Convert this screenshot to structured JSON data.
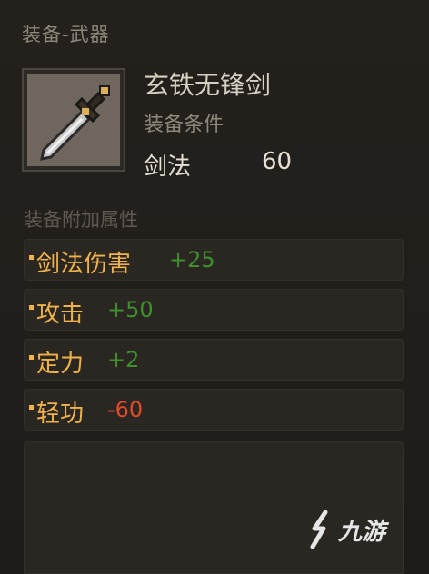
{
  "header": {
    "title": "装备-武器"
  },
  "item": {
    "name": "玄铁无锋剑",
    "requirement_label": "装备条件",
    "requirement_skill": "剑法",
    "requirement_value": "60"
  },
  "attributes": {
    "title": "装备附加属性",
    "rows": [
      {
        "label": "剑法伤害",
        "value": "+25",
        "color": "#3f8f2d"
      },
      {
        "label": "攻击",
        "value": "+50",
        "color": "#3f8f2d"
      },
      {
        "label": "定力",
        "value": "+2",
        "color": "#3f8f2d"
      },
      {
        "label": "轻功",
        "value": "-60",
        "color": "#e04a2a"
      }
    ]
  },
  "watermark": {
    "text": "九游",
    "icon": "jiuyou-logo-icon"
  }
}
